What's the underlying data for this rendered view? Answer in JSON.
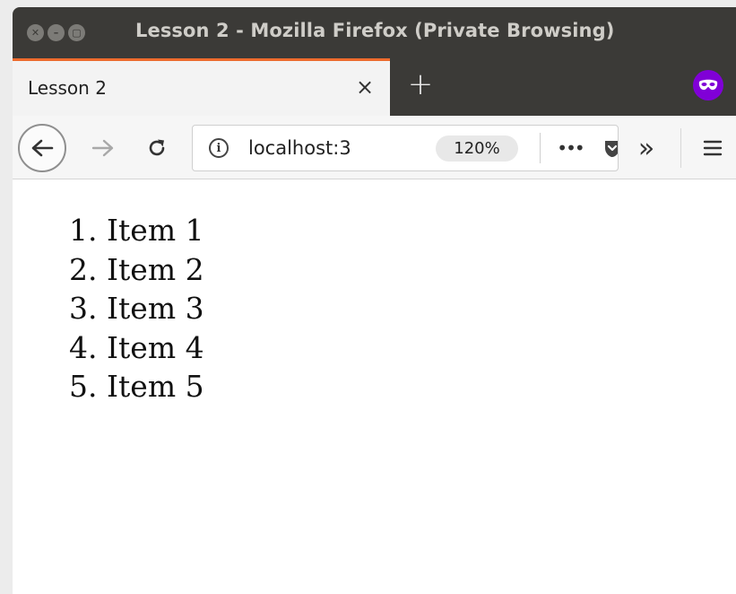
{
  "window": {
    "title": "Lesson 2 - Mozilla Firefox (Private Browsing)"
  },
  "tabs": [
    {
      "label": "Lesson 2",
      "active": true
    }
  ],
  "tab_controls": {
    "close_symbol": "×",
    "new_tab_symbol": "+"
  },
  "navbar": {
    "url": "localhost:3",
    "zoom": "120%",
    "page_actions_symbol": "•••",
    "overflow_symbol": "»"
  },
  "page": {
    "list_items": [
      {
        "number": "1.",
        "text": "Item 1"
      },
      {
        "number": "2.",
        "text": "Item 2"
      },
      {
        "number": "3.",
        "text": "Item 3"
      },
      {
        "number": "4.",
        "text": "Item 4"
      },
      {
        "number": "5.",
        "text": "Item 5"
      }
    ]
  },
  "colors": {
    "titlebar": "#3b3a37",
    "tab_accent": "#ee6b2d",
    "private_badge": "#8000d7"
  },
  "icons": [
    "window-close-icon",
    "window-minimize-icon",
    "window-maximize-icon",
    "private-browsing-mask-icon",
    "back-arrow-icon",
    "forward-arrow-icon",
    "reload-icon",
    "site-info-icon",
    "pocket-icon",
    "hamburger-menu-icon"
  ]
}
